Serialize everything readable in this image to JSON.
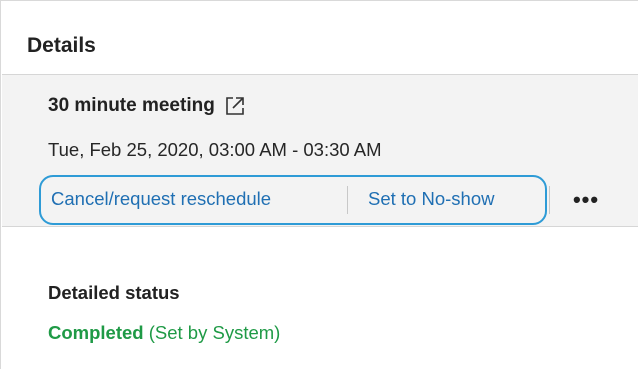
{
  "details": {
    "title": "Details"
  },
  "meeting": {
    "title": "30 minute meeting",
    "datetime": "Tue, Feb 25, 2020, 03:00 AM - 03:30 AM",
    "open_icon": "external-link-icon"
  },
  "actions": {
    "cancel_label": "Cancel/request reschedule",
    "noshow_label": "Set to No-show",
    "more_label": "•••",
    "highlight_color": "#2e9bd6",
    "link_color": "#1f6fb3"
  },
  "status": {
    "heading": "Detailed status",
    "value": "Completed",
    "source": "(Set by System)",
    "color": "#1f9a46"
  }
}
